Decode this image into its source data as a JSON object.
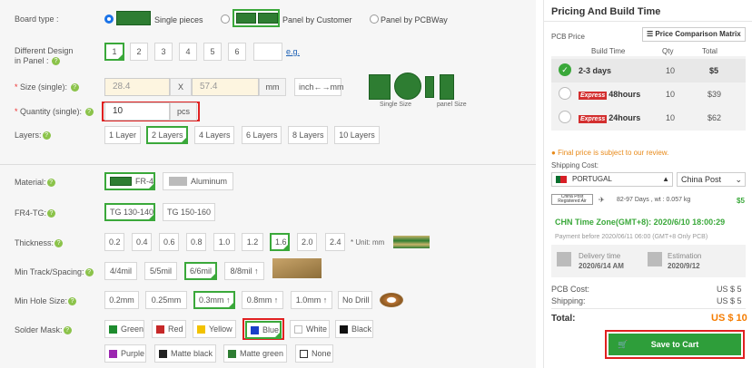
{
  "board_type": {
    "label": "Board type :",
    "options": [
      "Single pieces",
      "Panel by Customer",
      "Panel by PCBWay"
    ],
    "selected": "Single pieces"
  },
  "different_design": {
    "label1": "Different Design",
    "label2": "in Panel :",
    "options": [
      "1",
      "2",
      "3",
      "4",
      "5",
      "6"
    ],
    "selected": "1",
    "eg": "e.g."
  },
  "size": {
    "label": "Size (single):",
    "w": "28.4",
    "x": "X",
    "h": "57.4",
    "unit": "mm",
    "toggle": "inch←→mm",
    "img_labels": [
      "Single Size",
      "panel Size"
    ]
  },
  "quantity": {
    "label": "Quantity (single):",
    "value": "10",
    "unit": "pcs"
  },
  "layers": {
    "label": "Layers:",
    "options": [
      "1 Layer",
      "2 Layers",
      "4 Layers",
      "6 Layers",
      "8 Layers",
      "10 Layers"
    ],
    "selected": "2 Layers"
  },
  "material": {
    "label": "Material:",
    "options": [
      "FR-4",
      "Aluminum"
    ],
    "selected": "FR-4"
  },
  "fr4tg": {
    "label": "FR4-TG:",
    "options": [
      "TG 130-140",
      "TG 150-160"
    ],
    "selected": "TG 130-140"
  },
  "thickness": {
    "label": "Thickness:",
    "options": [
      "0.2",
      "0.4",
      "0.6",
      "0.8",
      "1.0",
      "1.2",
      "1.6",
      "2.0",
      "2.4"
    ],
    "selected": "1.6",
    "unit": "* Unit: mm"
  },
  "track": {
    "label": "Min Track/Spacing:",
    "options": [
      "4/4mil",
      "5/5mil",
      "6/6mil",
      "8/8mil ↑"
    ],
    "selected": "6/6mil"
  },
  "hole": {
    "label": "Min Hole Size:",
    "options": [
      "0.2mm",
      "0.25mm",
      "0.3mm ↑",
      "0.8mm ↑",
      "1.0mm ↑",
      "No Drill"
    ],
    "selected": "0.3mm ↑"
  },
  "solder": {
    "label": "Solder Mask:",
    "row1": [
      {
        "name": "Green",
        "color": "#1e8c2e"
      },
      {
        "name": "Red",
        "color": "#c62828"
      },
      {
        "name": "Yellow",
        "color": "#f2c200"
      },
      {
        "name": "Blue",
        "color": "#1a3fc9"
      },
      {
        "name": "White",
        "color": "#ffffff"
      },
      {
        "name": "Black",
        "color": "#111111"
      }
    ],
    "row2": [
      {
        "name": "Purple",
        "color": "#9c27b0"
      },
      {
        "name": "Matte black",
        "color": "#222222"
      },
      {
        "name": "Matte green",
        "color": "#2e7d32"
      },
      {
        "name": "None",
        "color": "#ffffff"
      }
    ],
    "selected": "Blue"
  },
  "panel": {
    "title": "Pricing And Build Time",
    "pcb_price": "PCB Price",
    "compare": "Price Comparison Matrix",
    "headers": [
      "Build Time",
      "Qty",
      "Total"
    ],
    "rows": [
      {
        "express": "",
        "time": "2-3 days",
        "qty": "10",
        "total": "$5"
      },
      {
        "express": "Express",
        "time": "48hours",
        "qty": "10",
        "total": "$39"
      },
      {
        "express": "Express",
        "time": "24hours",
        "qty": "10",
        "total": "$62"
      }
    ],
    "note": "Final price is subject to our review.",
    "ship_cost": "Shipping Cost:",
    "country": "PORTUGAL",
    "carrier": "China Post",
    "post_logo": "China Post Registered Air",
    "ship_days": "82-97 Days ,  wt : 0.057 kg",
    "ship_price": "$5",
    "tz": "CHN Time Zone(GMT+8): 2020/6/10 18:00:29",
    "pay_before": "Payment before 2020/06/11 06:00 (GMT+8 Only PCB)",
    "delivery_label": "Delivery time",
    "delivery_val": "2020/6/14 AM",
    "est_label": "Estimation",
    "est_val": "2020/9/12",
    "pcb_cost_label": "PCB Cost:",
    "pcb_cost": "US $ 5",
    "shipping_label": "Shipping:",
    "shipping": "US $ 5",
    "total_label": "Total:",
    "total": "US $ 10",
    "cart": "Save to Cart"
  }
}
